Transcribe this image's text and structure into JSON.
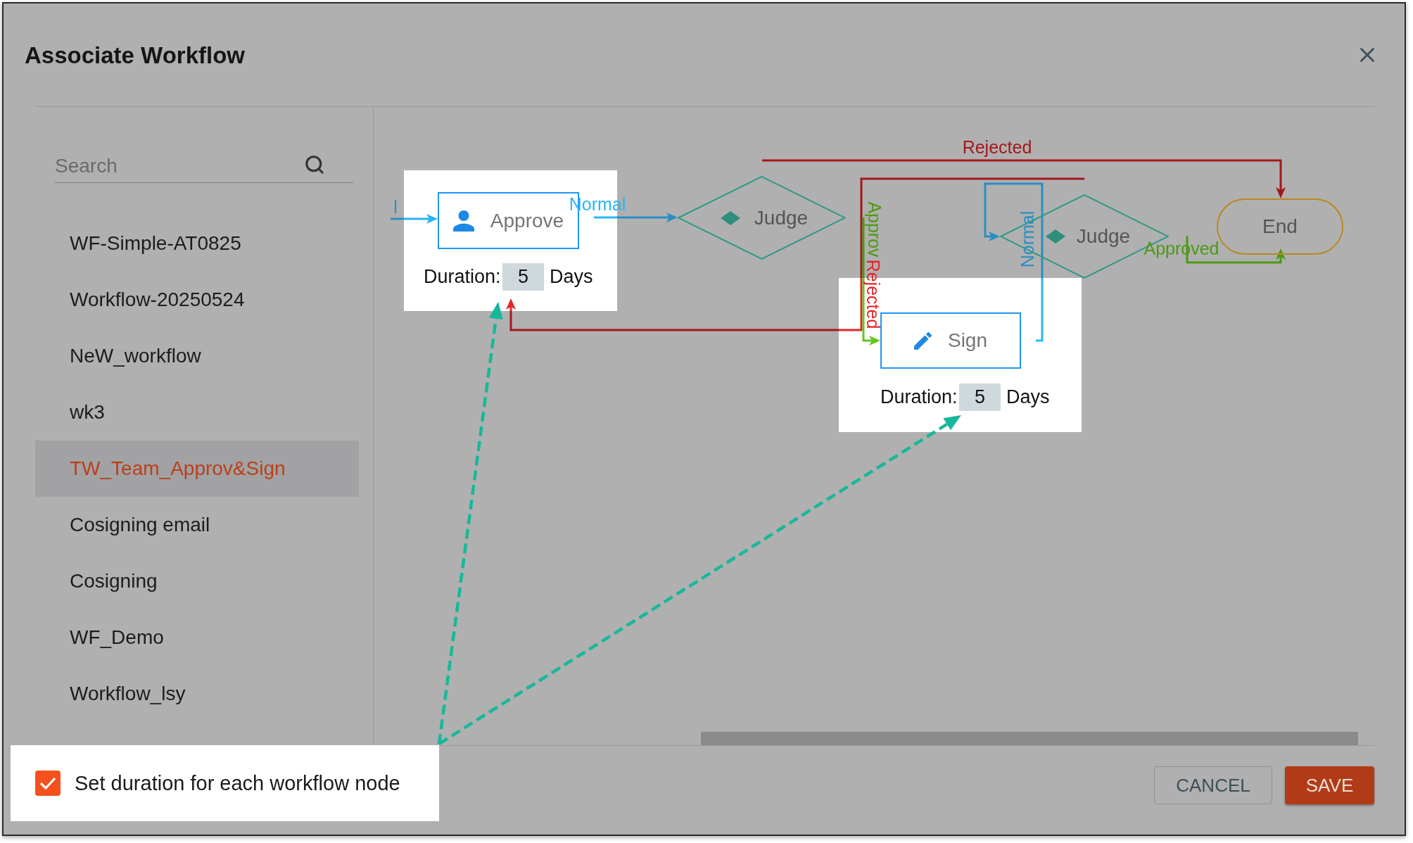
{
  "dialog": {
    "title": "Associate Workflow"
  },
  "sidebar": {
    "search": {
      "placeholder": "Search"
    },
    "items": [
      {
        "label": "WF-Simple-AT0825",
        "selected": false
      },
      {
        "label": "Workflow-20250524",
        "selected": false
      },
      {
        "label": "NeW_workflow",
        "selected": false
      },
      {
        "label": "wk3",
        "selected": false
      },
      {
        "label": "TW_Team_Approv&Sign",
        "selected": true
      },
      {
        "label": "Cosigning email",
        "selected": false
      },
      {
        "label": "Cosigning",
        "selected": false
      },
      {
        "label": "WF_Demo",
        "selected": false
      },
      {
        "label": "Workflow_lsy",
        "selected": false
      }
    ]
  },
  "diagram": {
    "nodes": [
      {
        "kind": "approval",
        "label": "Approve",
        "highlighted": true,
        "duration": {
          "label": "Duration:",
          "value": "5",
          "unit": "Days"
        }
      },
      {
        "kind": "decision",
        "label": "Judge",
        "highlighted": false
      },
      {
        "kind": "signature",
        "label": "Sign",
        "highlighted": true,
        "duration": {
          "label": "Duration:",
          "value": "5",
          "unit": "Days"
        }
      },
      {
        "kind": "decision",
        "label": "Judge",
        "highlighted": false
      },
      {
        "kind": "end",
        "label": "End",
        "highlighted": false
      }
    ],
    "edges": [
      {
        "kind": "normal",
        "label": "l"
      },
      {
        "kind": "normal",
        "label": "Normal"
      },
      {
        "kind": "rejected",
        "label": "Rejected"
      },
      {
        "kind": "rejected",
        "label": "Rejected"
      },
      {
        "kind": "approved",
        "label": "Approv"
      },
      {
        "kind": "normal",
        "label": "Normal"
      },
      {
        "kind": "approved",
        "label": "Approved"
      }
    ]
  },
  "footer": {
    "checkbox": {
      "label": "Set duration for each workflow node",
      "checked": true,
      "highlighted": true
    },
    "buttons": [
      {
        "label": "CANCEL",
        "kind": "secondary"
      },
      {
        "label": "SAVE",
        "kind": "primary"
      }
    ]
  }
}
